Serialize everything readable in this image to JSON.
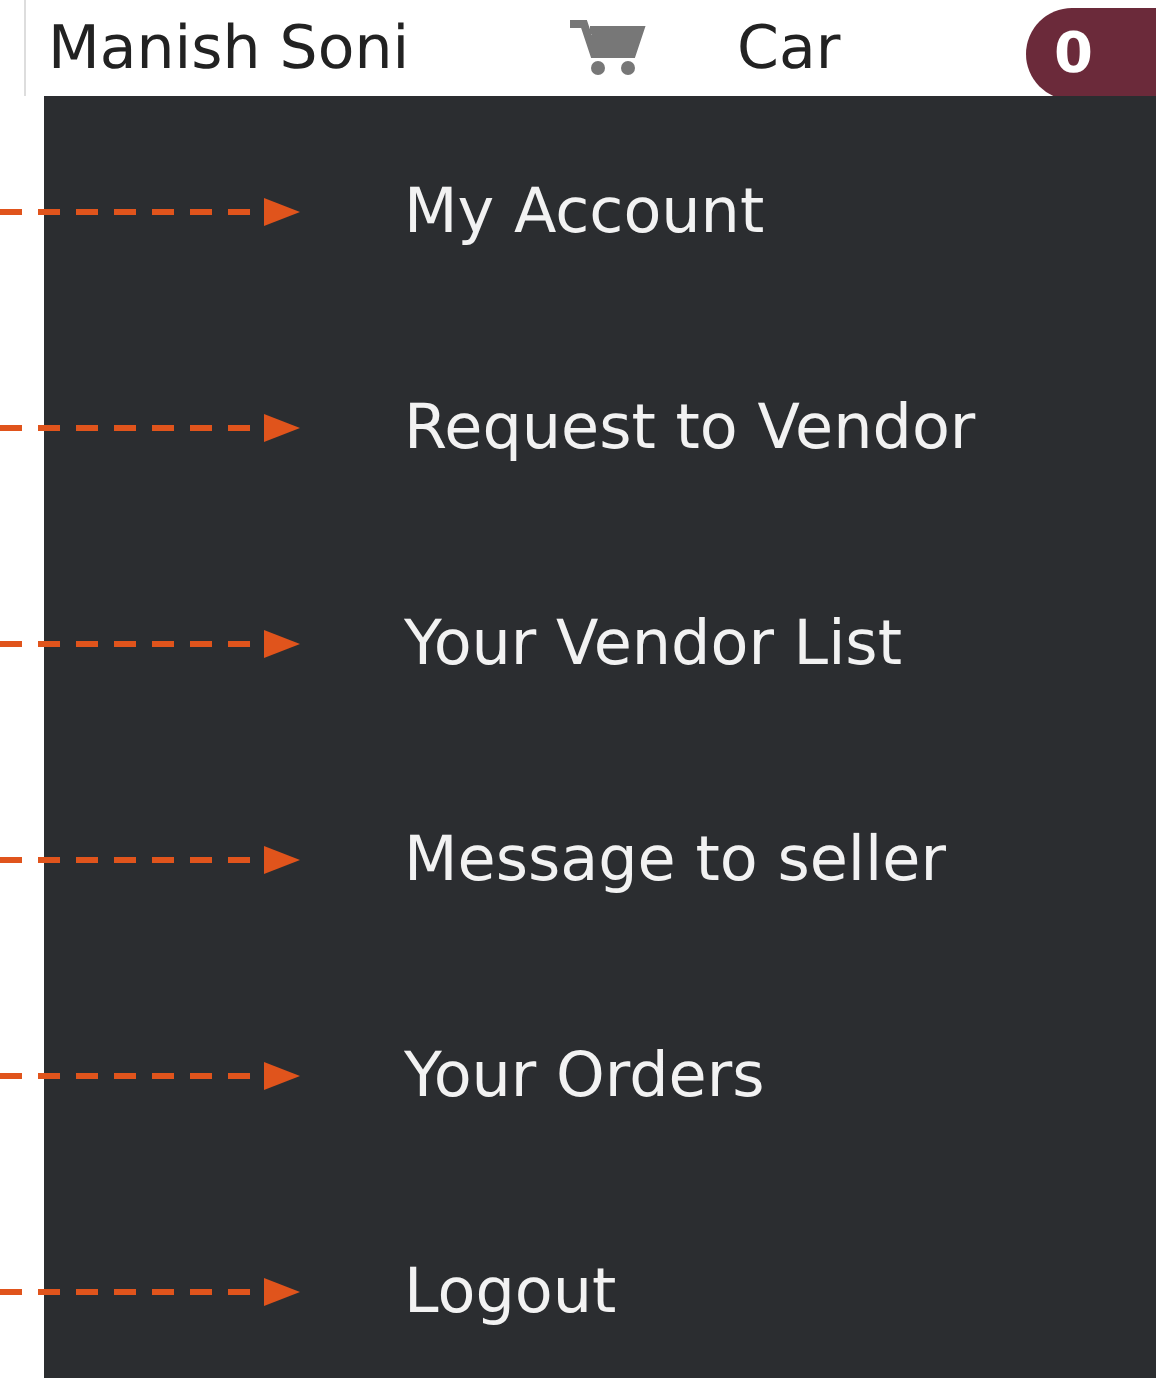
{
  "header": {
    "user_name": "Manish Soni",
    "cart_label": "Car",
    "cart_count": "0"
  },
  "menu": {
    "items": [
      {
        "label": "My Account"
      },
      {
        "label": "Request to Vendor"
      },
      {
        "label": "Your Vendor List"
      },
      {
        "label": "Message to seller"
      },
      {
        "label": "Your Orders"
      },
      {
        "label": "Logout"
      }
    ]
  }
}
